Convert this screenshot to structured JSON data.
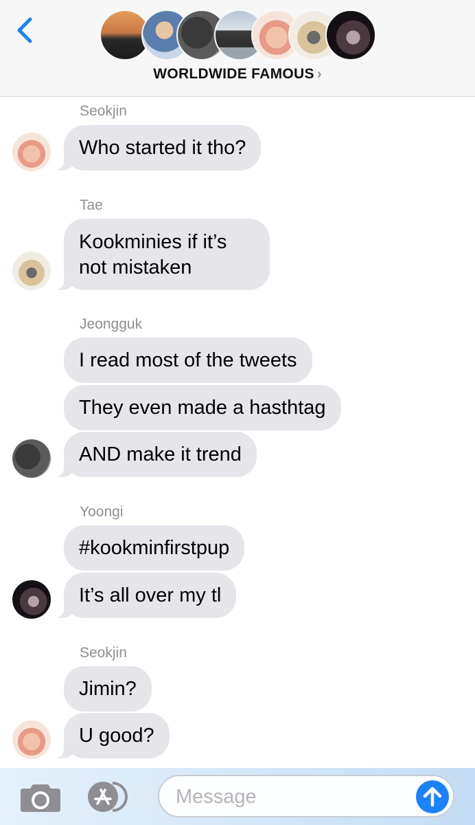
{
  "header": {
    "group_name": "WORLDWIDE FAMOUS",
    "chevron": "›",
    "back_icon": "chevron-left-icon",
    "member_avatars": [
      "sunset-photo",
      "blue-shirt-photo",
      "dark-hair-photo",
      "sky-photo",
      "pink-photo",
      "camera-photo",
      "night-photo"
    ]
  },
  "messages": [
    {
      "sender": "Seokjin",
      "bubbles": [
        "Who started it tho?"
      ]
    },
    {
      "sender": "Tae",
      "bubbles": [
        "Kookminies if it’s not mistaken"
      ]
    },
    {
      "sender": "Jeongguk",
      "bubbles": [
        "I read most of the tweets",
        "They even made a hasthtag",
        "AND make it trend"
      ]
    },
    {
      "sender": "Yoongi",
      "bubbles": [
        "#kookminfirstpup",
        "It’s all over my tl"
      ]
    },
    {
      "sender": "Seokjin",
      "bubbles": [
        "Jimin?",
        "U good?"
      ]
    }
  ],
  "composer": {
    "placeholder": "Message",
    "camera_icon": "camera-icon",
    "apps_icon": "app-store-icon",
    "send_icon": "arrow-up-icon",
    "send_color": "#1a82fb"
  },
  "colors": {
    "accent": "#1a82fb",
    "bubble": "#e5e5ea",
    "sender_label": "#8e8e93"
  }
}
